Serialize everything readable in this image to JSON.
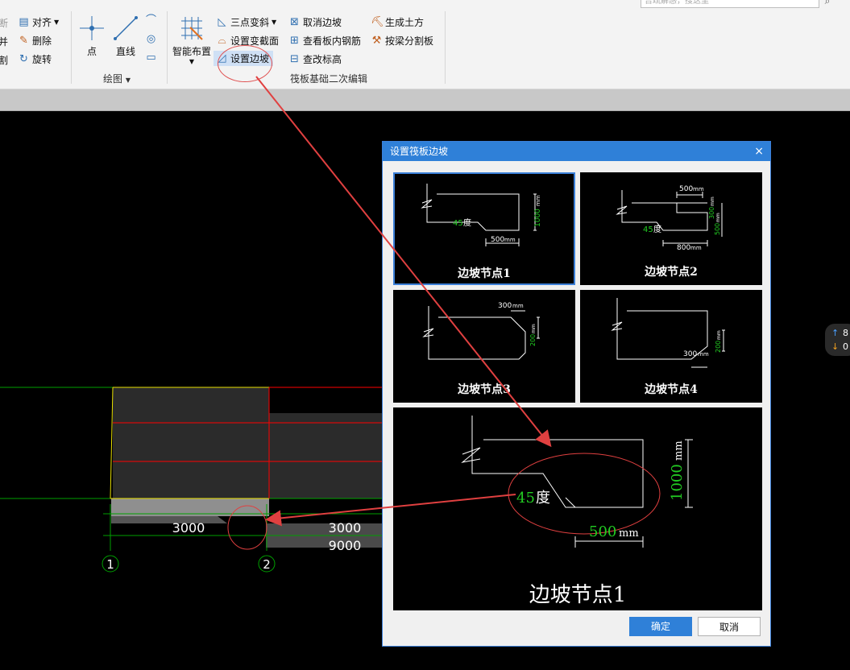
{
  "search": {
    "placeholder": "告疏解惑，搜这里"
  },
  "ribbon": {
    "left_partial": {
      "items": [
        "断",
        "并",
        "割"
      ]
    },
    "modify": {
      "align": "对齐",
      "delete": "删除",
      "rotate": "旋转"
    },
    "draw": {
      "point": "点",
      "line": "直线",
      "group_label": "绘图"
    },
    "smart_layout": "智能布置",
    "raft_edit": {
      "three_point_slope": "三点变斜",
      "set_variable_section": "设置变截面",
      "set_edge_slope": "设置边坡",
      "cancel_edge_slope": "取消边坡",
      "view_rebar": "查看板内钢筋",
      "check_elevation": "查改标高",
      "generate_earthwork": "生成土方",
      "split_by_beam": "按梁分割板",
      "group_label": "筏板基础二次编辑"
    }
  },
  "cad": {
    "dims": {
      "span1": "3000",
      "span2": "3000",
      "total": "9000"
    },
    "axes": [
      "1",
      "2"
    ]
  },
  "dialog": {
    "title": "设置筏板边坡",
    "close": "×",
    "thumbs": [
      {
        "label": "边坡节点1",
        "t1": "45",
        "t2": "度",
        "t3": "500",
        "t4": "mm",
        "t5": "1000",
        "t6": "mm"
      },
      {
        "label": "边坡节点2",
        "t1": "500",
        "t2": "mm",
        "t3": "45",
        "t4": "度",
        "t5": "800",
        "t6": "mm",
        "t7": "300",
        "t8": "mm",
        "t9": "500",
        "t10": "mm"
      },
      {
        "label": "边坡节点3",
        "t1": "300",
        "t2": "mm",
        "t3": "200",
        "t4": "mm"
      },
      {
        "label": "边坡节点4",
        "t1": "300",
        "t2": "mm",
        "t3": "200",
        "t4": "mm"
      }
    ],
    "preview": {
      "label": "边坡节点1",
      "angle": "45",
      "angle_unit": "度",
      "width": "500",
      "width_unit": "mm",
      "height": "1000",
      "height_unit": "mm"
    },
    "ok": "确定",
    "cancel": "取消"
  },
  "side_pill": {
    "up": "8",
    "down": "0"
  },
  "colors": {
    "accent": "#2f80d8",
    "annotation": "#e04040",
    "grid_red": "#ff0000",
    "grid_green": "#00a000",
    "dim_green": "#22cc22"
  }
}
